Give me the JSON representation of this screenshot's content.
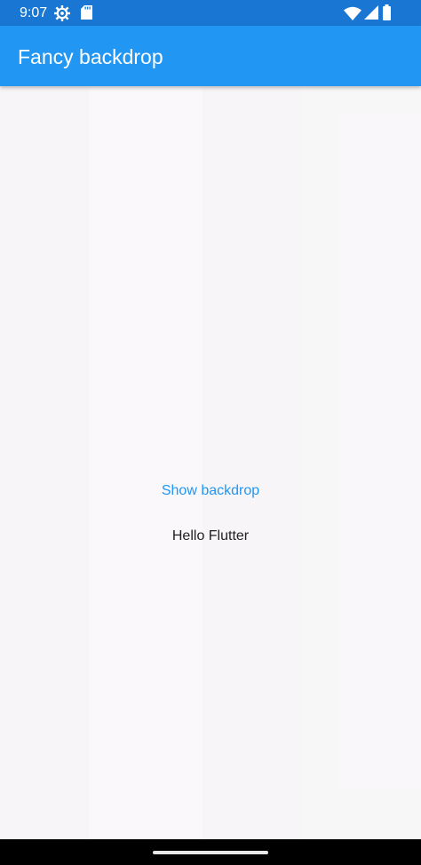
{
  "status_bar": {
    "time": "9:07",
    "icons": [
      "settings-icon",
      "sd-card-icon",
      "wifi-icon",
      "signal-icon",
      "battery-icon"
    ]
  },
  "app_bar": {
    "title": "Fancy backdrop",
    "color": "#2196f3"
  },
  "main": {
    "button_label": "Show backdrop",
    "body_text": "Hello Flutter"
  },
  "colors": {
    "accent": "#2196f3",
    "status_bar": "#1976d2",
    "background": "#f7f5f7"
  }
}
